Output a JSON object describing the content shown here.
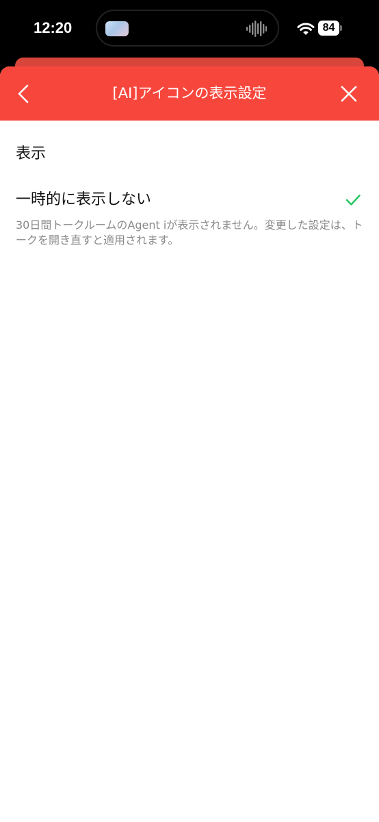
{
  "status_bar": {
    "time": "12:20",
    "battery_level": "84",
    "icons": [
      "now-playing-thumbnail",
      "audio-waveform-icon",
      "wifi-icon",
      "battery-icon"
    ]
  },
  "header": {
    "title": "[AI]アイコンの表示設定",
    "back_icon": "chevron-left-icon",
    "close_icon": "close-icon",
    "background_color": "#f7473d"
  },
  "options": [
    {
      "label": "表示",
      "selected": false
    },
    {
      "label": "一時的に表示しない",
      "selected": true,
      "description": "30日間トークルームのAgent iが表示されません。変更した設定は、トークを開き直すと適用されます。"
    }
  ],
  "colors": {
    "accent": "#f7473d",
    "check": "#22c55e"
  }
}
